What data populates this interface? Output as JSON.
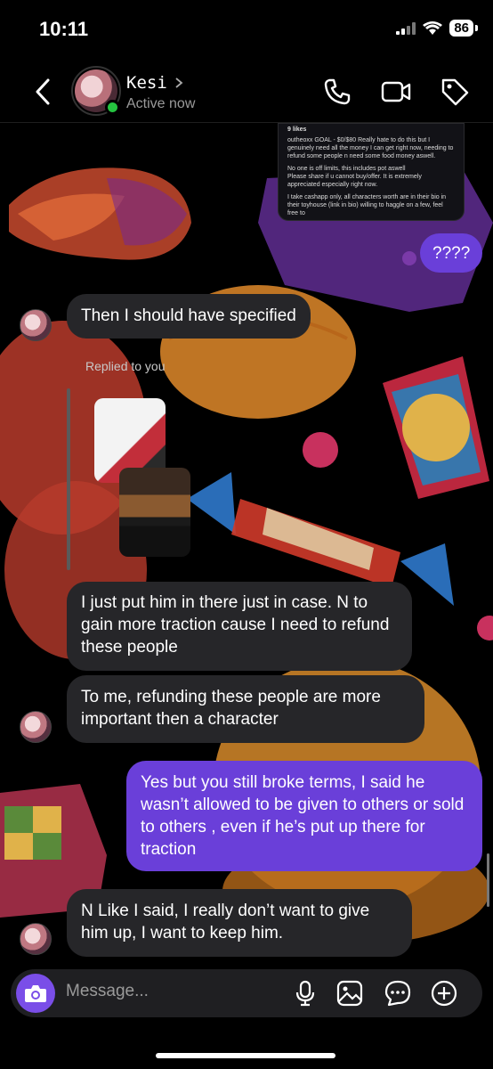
{
  "status": {
    "time": "10:11",
    "battery": "86"
  },
  "header": {
    "name": "Kesi",
    "status": "Active now"
  },
  "shared_post": {
    "likes": "9 likes",
    "caption": "outheoxx GOAL - $0/$80 Really hate to do this but I genuinely need all the money I can get right now, needing to refund some people n need some food money aswell.",
    "line2": "No one is off limits, this includes pot aswell",
    "line3": "Please share if u cannot buy/offer. It is extremely appreciated especially right now.",
    "line4": "I take cashapp only, all characters worth are in their bio in their toyhouse (link in bio) willing to haggle on a few, feel free to"
  },
  "messages": [
    {
      "id": "m1",
      "text": "????"
    },
    {
      "id": "m2",
      "text": "Then I should have specified"
    },
    {
      "id": "m3",
      "text": "I just put him in there just in case. N to gain more traction cause I need to refund these people"
    },
    {
      "id": "m4",
      "text": "To me, refunding these people are more important then a character"
    },
    {
      "id": "m5",
      "text": "Yes but you still broke terms, I said he wasn’t allowed to be given to others or sold to others , even if he’s put up there for traction"
    },
    {
      "id": "m6",
      "text": "N Like I said, I really don’t want to give him up, I want to keep him."
    }
  ],
  "reply": {
    "label": "Replied to you"
  },
  "composer": {
    "placeholder": "Message..."
  },
  "colors": {
    "outgoing": "#6a3fd9",
    "incoming": "#262629",
    "online": "#25c440"
  }
}
